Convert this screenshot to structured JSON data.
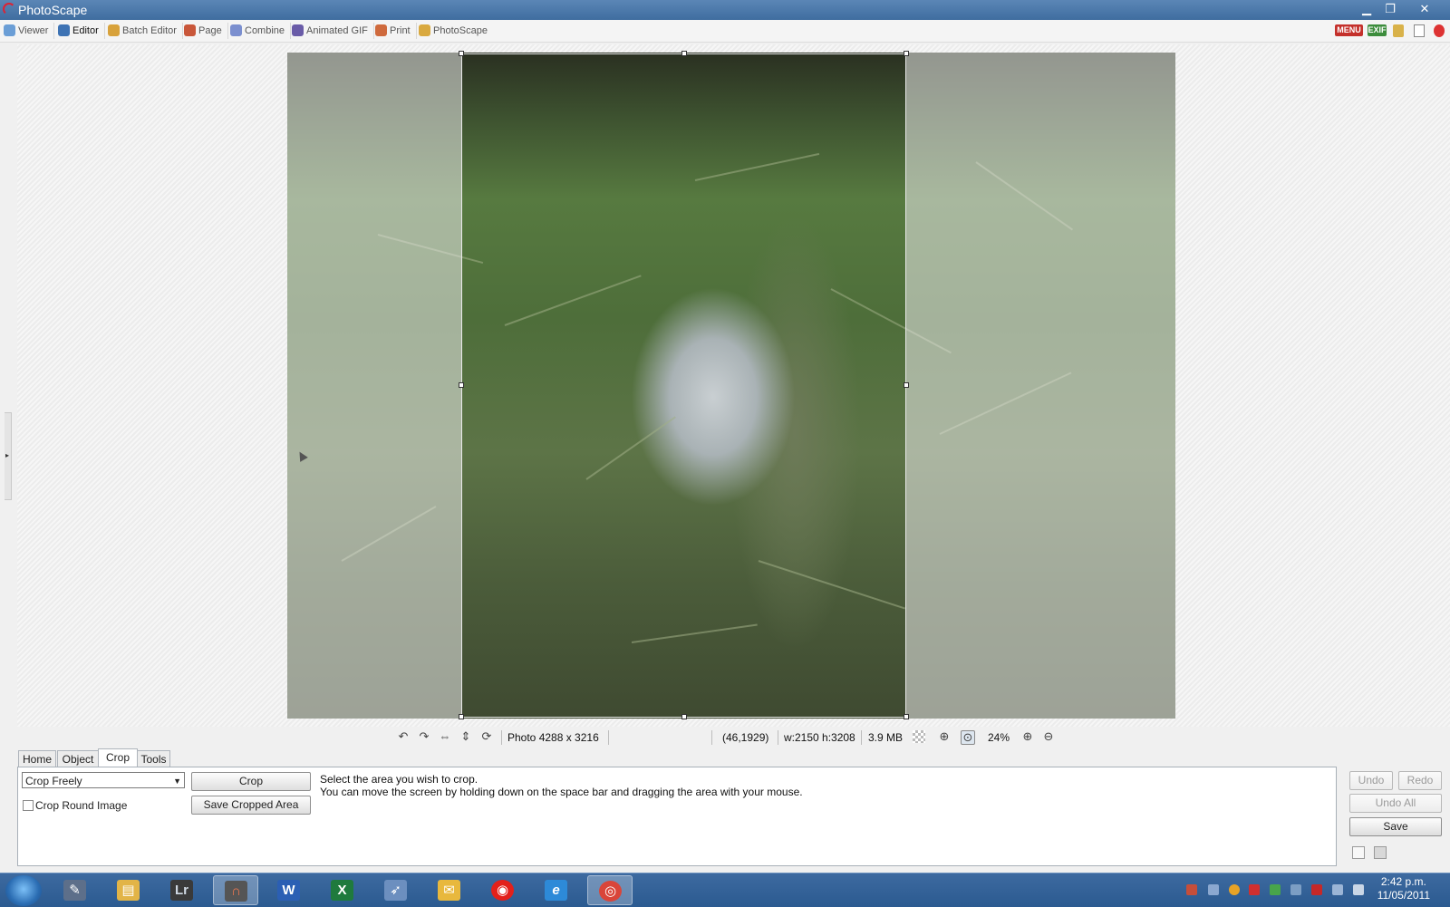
{
  "window": {
    "title": "PhotoScape"
  },
  "main_tabs": [
    {
      "label": "Viewer"
    },
    {
      "label": "Editor"
    },
    {
      "label": "Batch Editor"
    },
    {
      "label": "Page"
    },
    {
      "label": "Combine"
    },
    {
      "label": "Animated GIF"
    },
    {
      "label": "Print"
    },
    {
      "label": "PhotoScape"
    }
  ],
  "toolbar_right": {
    "menu_label": "MENU",
    "exif_label": "EXIF"
  },
  "status": {
    "photo_info": "Photo 4288 x 3216",
    "coords": "(46,1929)",
    "selection": "w:2150 h:3208",
    "file_size": "3.9 MB",
    "zoom": "24%"
  },
  "panel_tabs": [
    {
      "label": "Home"
    },
    {
      "label": "Object"
    },
    {
      "label": "Crop"
    },
    {
      "label": "Tools"
    }
  ],
  "crop": {
    "mode_value": "Crop Freely",
    "crop_button": "Crop",
    "save_cropped_button": "Save Cropped Area",
    "round_label": "Crop Round Image",
    "round_checked": false,
    "help_line1": "Select the area you wish to crop.",
    "help_line2": "You can move the screen by holding down on the space bar and dragging the area with your mouse."
  },
  "actions": {
    "undo": "Undo",
    "redo": "Redo",
    "undo_all": "Undo All",
    "save": "Save"
  },
  "taskbar": {
    "apps": [
      {
        "name": "pen-app",
        "glyph": "✎"
      },
      {
        "name": "explorer",
        "glyph": "▤"
      },
      {
        "name": "lightroom",
        "glyph": "Lr"
      },
      {
        "name": "photoscape",
        "glyph": "∩"
      },
      {
        "name": "word",
        "glyph": "W"
      },
      {
        "name": "excel",
        "glyph": "X"
      },
      {
        "name": "pointer-app",
        "glyph": "➶"
      },
      {
        "name": "outlook",
        "glyph": "✉"
      },
      {
        "name": "vodafone",
        "glyph": "◉"
      },
      {
        "name": "internet-explorer",
        "glyph": "e"
      },
      {
        "name": "chrome",
        "glyph": "◎"
      }
    ],
    "time": "2:42 p.m.",
    "date": "11/05/2011"
  }
}
